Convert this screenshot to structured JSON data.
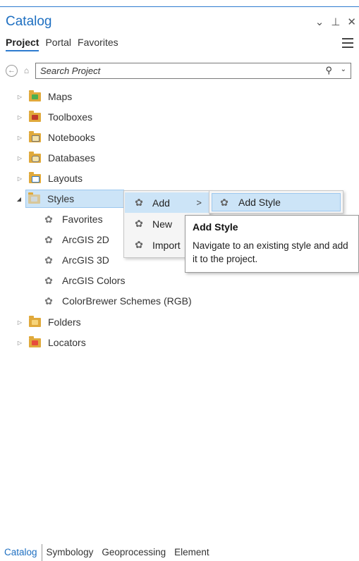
{
  "pane": {
    "title": "Catalog",
    "controls": [
      "⌄",
      "⊥",
      "✕"
    ]
  },
  "tabs": [
    {
      "label": "Project",
      "active": true
    },
    {
      "label": "Portal",
      "active": false
    },
    {
      "label": "Favorites",
      "active": false
    }
  ],
  "search": {
    "placeholder": "Search Project"
  },
  "tree": [
    {
      "label": "Maps",
      "expanded": false,
      "icon": "maps-folder-icon"
    },
    {
      "label": "Toolboxes",
      "expanded": false,
      "icon": "toolboxes-folder-icon"
    },
    {
      "label": "Notebooks",
      "expanded": false,
      "icon": "notebooks-folder-icon"
    },
    {
      "label": "Databases",
      "expanded": false,
      "icon": "databases-folder-icon"
    },
    {
      "label": "Layouts",
      "expanded": false,
      "icon": "layouts-folder-icon"
    },
    {
      "label": "Styles",
      "expanded": true,
      "selected": true,
      "icon": "styles-folder-icon"
    },
    {
      "label": "Favorites",
      "child": true,
      "icon": "style-palette-icon"
    },
    {
      "label": "ArcGIS 2D",
      "child": true,
      "icon": "style-palette-icon"
    },
    {
      "label": "ArcGIS 3D",
      "child": true,
      "icon": "style-palette-icon"
    },
    {
      "label": "ArcGIS Colors",
      "child": true,
      "icon": "style-palette-icon"
    },
    {
      "label": "ColorBrewer Schemes (RGB)",
      "child": true,
      "icon": "style-palette-icon"
    },
    {
      "label": "Folders",
      "expanded": false,
      "icon": "folders-folder-icon"
    },
    {
      "label": "Locators",
      "expanded": false,
      "icon": "locators-folder-icon"
    }
  ],
  "context_menu": {
    "items": [
      {
        "label": "Add",
        "highlighted": true,
        "has_submenu": true
      },
      {
        "label": "New"
      },
      {
        "label": "Import"
      }
    ],
    "submenu": {
      "label": "Add Style"
    }
  },
  "tooltip": {
    "title": "Add Style",
    "body": "Navigate to an existing style and add it to the project."
  },
  "bottom_tabs": [
    {
      "label": "Catalog",
      "active": true
    },
    {
      "label": "Symbology"
    },
    {
      "label": "Geoprocessing"
    },
    {
      "label": "Element"
    }
  ],
  "colors": {
    "accent": "#1e6fc1",
    "selection": "#cce4f7",
    "folder": "#e0a93b"
  }
}
